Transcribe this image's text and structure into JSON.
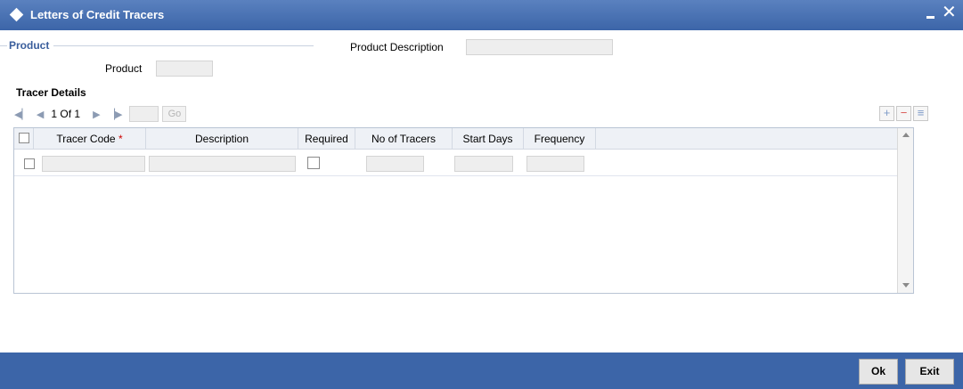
{
  "window": {
    "title": "Letters of Credit Tracers"
  },
  "product_section": {
    "legend": "Product",
    "product_label": "Product",
    "product_value": "",
    "product_description_label": "Product Description",
    "product_description_value": ""
  },
  "tracer_details": {
    "title": "Tracer Details",
    "pager": {
      "text": "1 Of 1",
      "go_label": "Go",
      "page_input": ""
    },
    "columns": [
      {
        "label": "Tracer Code",
        "required": true
      },
      {
        "label": "Description",
        "required": false
      },
      {
        "label": "Required",
        "required": false
      },
      {
        "label": "No of Tracers",
        "required": false
      },
      {
        "label": "Start Days",
        "required": false
      },
      {
        "label": "Frequency",
        "required": false
      }
    ],
    "required_marker": "*",
    "rows": [
      {
        "tracer_code": "",
        "description": "",
        "required": false,
        "no_of_tracers": "",
        "start_days": "",
        "frequency": ""
      }
    ],
    "icons": {
      "first": "first-page-icon",
      "prev": "previous-page-icon",
      "next": "next-page-icon",
      "last": "last-page-icon",
      "add": "add-row-icon",
      "delete": "delete-row-icon",
      "view": "view-row-icon"
    }
  },
  "footer": {
    "ok_label": "Ok",
    "exit_label": "Exit"
  },
  "colors": {
    "titlebar": "#3c65a8",
    "legend": "#3a5e9c",
    "required": "#cc0000"
  }
}
